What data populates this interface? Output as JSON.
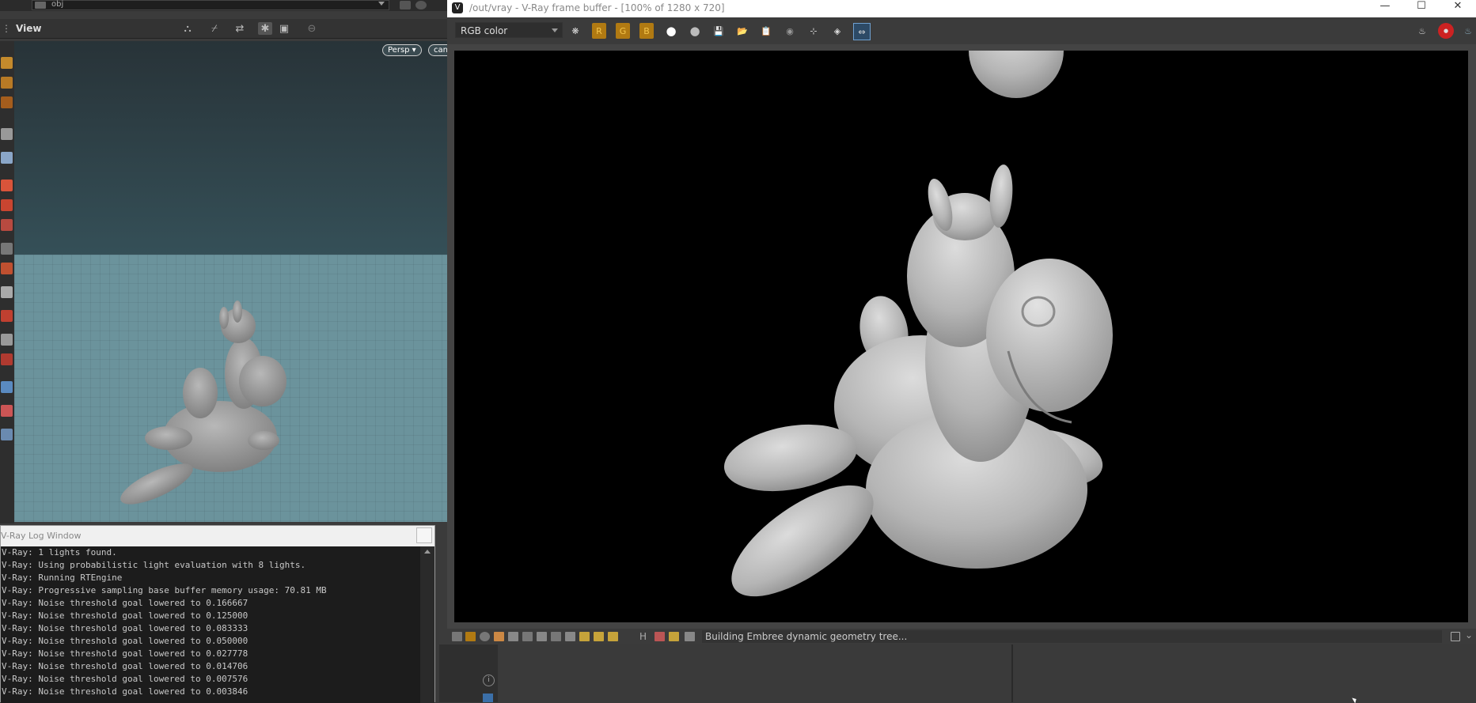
{
  "houdini": {
    "path_field": "obj",
    "pane_title": "View",
    "camera_menu": "Persp ▾",
    "camera_menu_2": "can"
  },
  "log_window": {
    "title": "V-Ray Log Window",
    "lines": [
      "V-Ray: 1 lights found.",
      "V-Ray: Using probabilistic light evaluation with 8 lights.",
      "V-Ray: Running RTEngine",
      "V-Ray: Progressive sampling base buffer memory usage: 70.81 MB",
      "V-Ray: Noise threshold goal lowered to 0.166667",
      "V-Ray: Noise threshold goal lowered to 0.125000",
      "V-Ray: Noise threshold goal lowered to 0.083333",
      "V-Ray: Noise threshold goal lowered to 0.050000",
      "V-Ray: Noise threshold goal lowered to 0.027778",
      "V-Ray: Noise threshold goal lowered to 0.014706",
      "V-Ray: Noise threshold goal lowered to 0.007576",
      "V-Ray: Noise threshold goal lowered to 0.003846"
    ]
  },
  "vfb": {
    "title": "/out/vray - V-Ray frame buffer - [100% of 1280 x 720]",
    "channel": "RGB color",
    "channel_buttons": [
      "R",
      "G",
      "B"
    ],
    "status": "Building Embree dynamic geometry tree...",
    "status_letter": "H",
    "window_controls": {
      "minimize": "—",
      "maximize": "☐",
      "close": "✕"
    },
    "colors": {
      "accent_channel": "#b17a12",
      "background": "#000000",
      "model": "#bdbdbd"
    }
  }
}
